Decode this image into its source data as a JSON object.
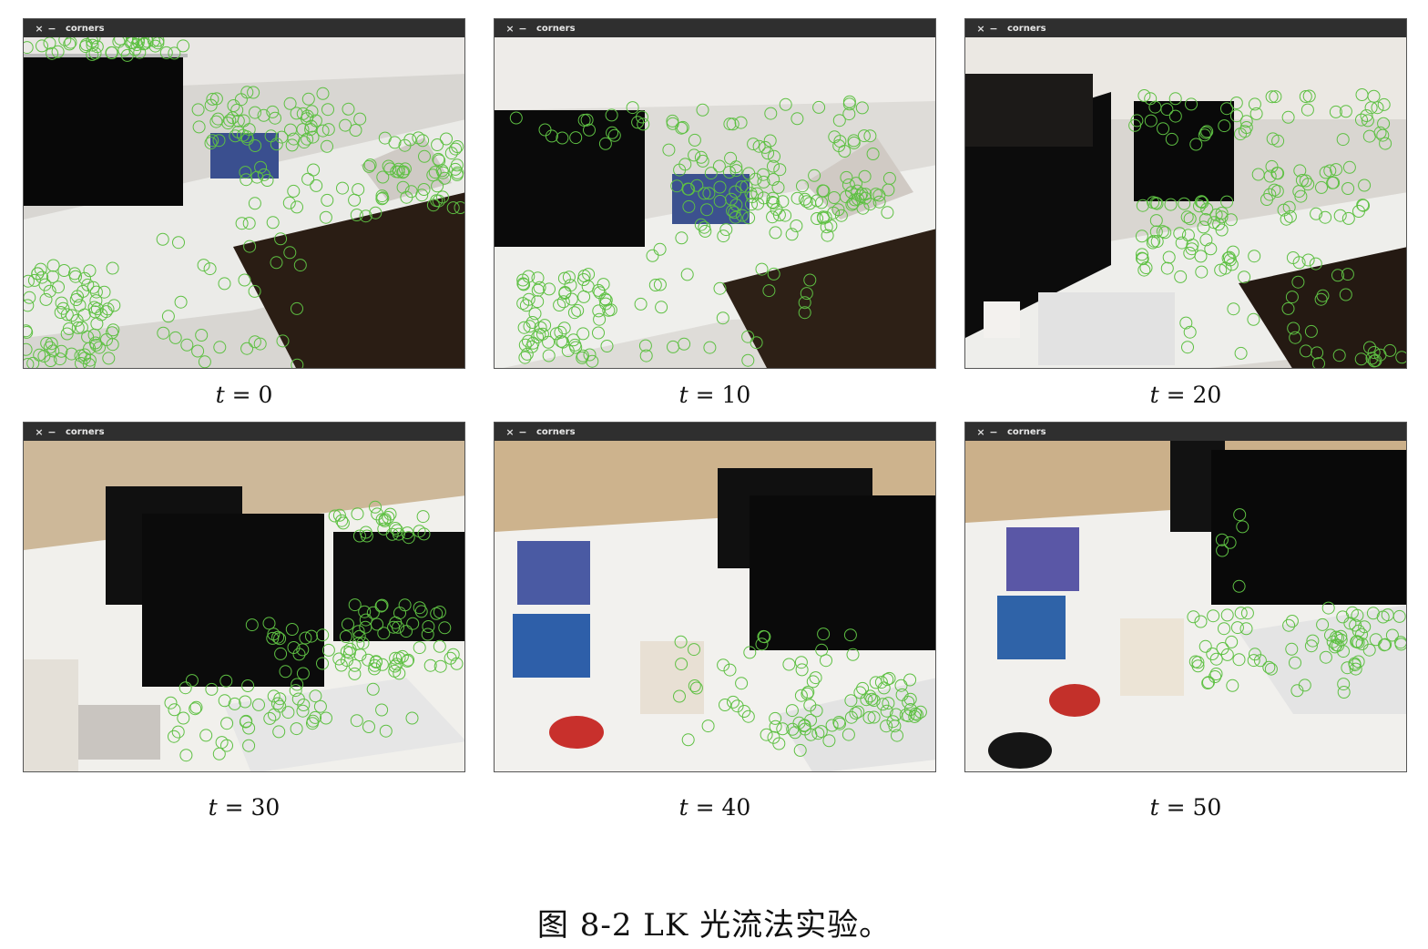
{
  "window": {
    "title": "corners",
    "close_symbol": "×",
    "minimize_symbol": "−"
  },
  "frames": [
    {
      "t_var": "t",
      "t_rest": " = 0"
    },
    {
      "t_var": "t",
      "t_rest": " = 10"
    },
    {
      "t_var": "t",
      "t_rest": " = 20"
    },
    {
      "t_var": "t",
      "t_rest": " = 30"
    },
    {
      "t_var": "t",
      "t_rest": " = 40"
    },
    {
      "t_var": "t",
      "t_rest": " = 50"
    }
  ],
  "figure_caption": "图 8-2   LK 光流法实验。",
  "colors": {
    "keypoint": "#5ec043",
    "titlebar": "#2f2f2f"
  }
}
